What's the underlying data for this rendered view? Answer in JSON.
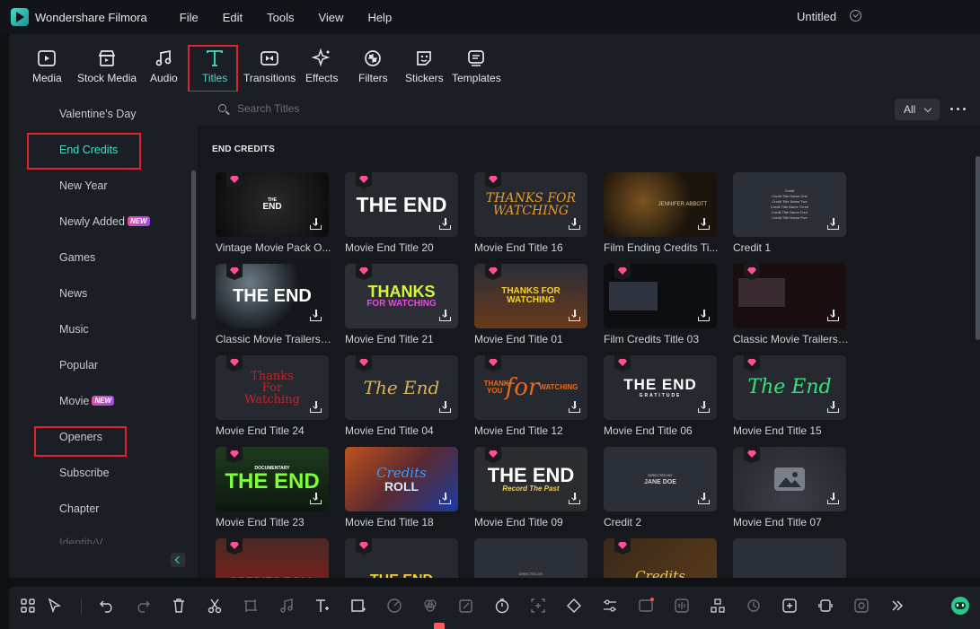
{
  "app": {
    "name": "Wondershare Filmora",
    "document_title": "Untitled"
  },
  "menu": [
    "File",
    "Edit",
    "Tools",
    "View",
    "Help"
  ],
  "toolbar": {
    "media": "Media",
    "stock_media": "Stock Media",
    "audio": "Audio",
    "titles": "Titles",
    "transitions": "Transitions",
    "effects": "Effects",
    "filters": "Filters",
    "stickers": "Stickers",
    "templates": "Templates",
    "active": "Titles"
  },
  "sidebar": {
    "categories": [
      "Valentine's Day",
      "End Credits",
      "New Year",
      "Newly Added",
      "Games",
      "News",
      "Music",
      "Popular",
      "Movie",
      "Openers",
      "Subscribe",
      "Chapter",
      "IdentityV"
    ],
    "active": "End Credits",
    "new_badge": "NEW"
  },
  "search": {
    "placeholder": "Search Titles",
    "filter": "All"
  },
  "section_title": "END CREDITS",
  "cards": [
    [
      "Vintage Movie Pack O...",
      "Movie End Title 20",
      "Movie End Title 16",
      "Film Ending Credits Ti...",
      "Credit 1"
    ],
    [
      "Classic Movie Trailers ...",
      "Movie End Title 21",
      "Movie End Title 01",
      "Film Credits Title 03",
      "Classic Movie Trailers ..."
    ],
    [
      "Movie End Title 24",
      "Movie End Title 04",
      "Movie End Title 12",
      "Movie End Title 06",
      "Movie End Title 15"
    ],
    [
      "Movie End Title 23",
      "Movie End Title 18",
      "Movie End Title 09",
      "Credit 2",
      "Movie End Title 07"
    ]
  ],
  "thumb_text": {
    "t_end": "THE END",
    "t_end_small": "END",
    "t_the": "THE",
    "thanks_watching": "THANKS FOR WATCHING",
    "thanks": "THANKS",
    "for_watching": "FOR WATCHING",
    "thanks_for_watching_red": "Thanks For Watching",
    "the_end_script": "The End",
    "thank_you": "THANK YOU",
    "for_script": "for",
    "watching": "WATCHING",
    "gratitude": "GRATITUDE",
    "documentary": "DOCUMENTARY",
    "credits": "Credits",
    "roll": "ROLL",
    "record_the_past": "Record The Past",
    "jane_doe": "JANE DOE",
    "directed_by": "DIRECTED BY",
    "jennifer_abbott": "JENNIFER ABBOTT",
    "credits_roll": "CREDITS ROLL",
    "credit_title": "Credit",
    "credit_rows": [
      "Credit Title   Name One",
      "Credit Title   Name Two",
      "Credit Title   Name Three",
      "Credit Title   Name Four",
      "Credit Title   Name Five"
    ]
  },
  "colors": {
    "accent": "#3fe0c6",
    "highlight": "#e0242a",
    "premium": "#ff4f9a"
  }
}
